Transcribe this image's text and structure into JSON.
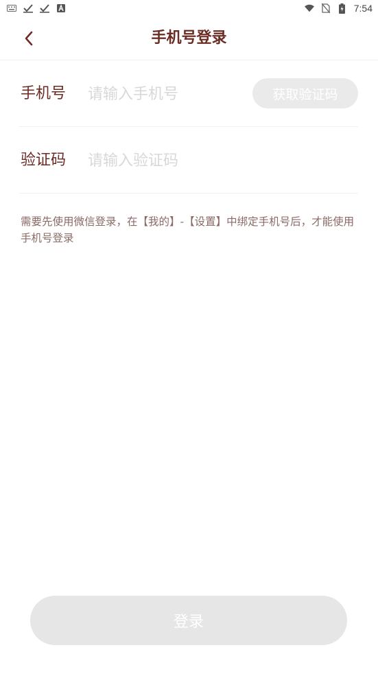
{
  "status_bar": {
    "time": "7:54",
    "left_icons": [
      "keyboard-icon",
      "check-icon",
      "check-icon",
      "app-a-icon"
    ],
    "right_icons": [
      "wifi-icon",
      "no-sim-icon",
      "battery-charging-icon"
    ]
  },
  "header": {
    "title": "手机号登录",
    "back_icon": "chevron-left-icon",
    "accent_color": "#6b2c24"
  },
  "form": {
    "phone": {
      "label": "手机号",
      "placeholder": "请输入手机号",
      "value": "",
      "code_button_label": "获取验证码"
    },
    "code": {
      "label": "验证码",
      "placeholder": "请输入验证码",
      "value": ""
    }
  },
  "hint": "需要先使用微信登录，在【我的】-【设置】中绑定手机号后，才能使用手机号登录",
  "login_button_label": "登录"
}
